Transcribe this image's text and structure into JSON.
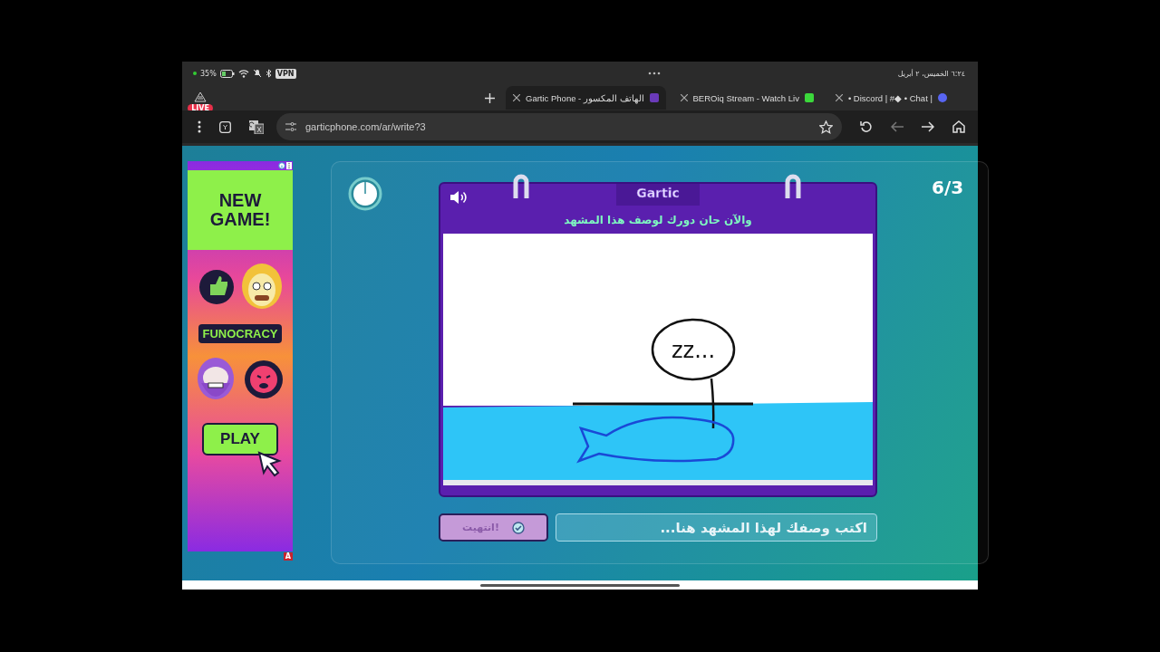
{
  "status_bar": {
    "battery": "35%",
    "vpn": "VPN",
    "datetime": "٦:٢٤ الخميس، ٢ أبريل"
  },
  "browser": {
    "live_badge": "LIVE",
    "tabs": [
      {
        "title": "Gartic Phone - الهاتف المكسور",
        "selected": true
      },
      {
        "title": "BEROiq Stream - Watch Liv",
        "selected": false
      },
      {
        "title": "• Discord | #◆ • Chat |",
        "selected": false
      }
    ],
    "url": "garticphone.com/ar/write?3"
  },
  "ad": {
    "headline": "NEW GAME!",
    "game": "FUNOCRACY",
    "button": "PLAY",
    "badge": "A"
  },
  "game": {
    "round": "6/3",
    "logo": "Gartic",
    "prompt": "والآن حان دورك لوصف هذا المشهد",
    "drawing_text": "zz...",
    "answer": {
      "placeholder": "اكتب وصفك لهذا المشهد هنا..."
    },
    "done_button": "انتهيت!"
  }
}
